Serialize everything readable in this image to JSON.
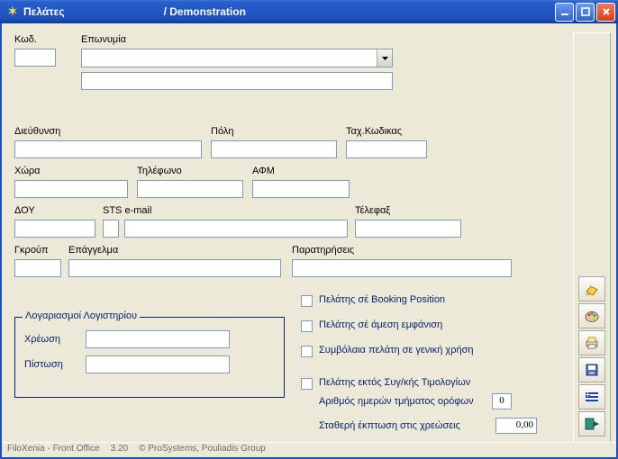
{
  "window": {
    "title": "Πελάτες",
    "subtitle": "/ Demonstration"
  },
  "labels": {
    "kod": "Κωδ.",
    "eponymia": "Επωνυμία",
    "dieythinsi": "Διεύθυνση",
    "poli": "Πόλη",
    "tax_kodikas": "Ταχ.Κωδικας",
    "xora": "Χώρα",
    "tilefono": "Τηλέφωνο",
    "afm": "ΑΦΜ",
    "doy": "ΔΟΥ",
    "sts_email": "STS e-mail",
    "telefax": "Τέλεφαξ",
    "group": "Γκρούπ",
    "epaggelma": "Επάγγελμα",
    "paratiriseis": "Παρατηρήσεις",
    "logariasmoi": "Λογαριασμοί Λογιστηρίου",
    "xreosi": "Χρέωση",
    "pistosi": "Πίστωση",
    "chk_booking": "Πελάτης σέ Booking Position",
    "chk_amesi": "Πελάτης σέ άμεση εμφάνιση",
    "chk_symvolaia": "Συμβόλαια πελάτη σε γενική χρήση",
    "chk_ektos": "Πελάτης εκτός Συγ/κής Τιμολογίων",
    "arithmos_imeron": "Αριθμός ημερών τμήματος ορόφων",
    "statheri_ekptosi": "Σταθερή έκπτωση στις χρεώσεις"
  },
  "values": {
    "kod": "",
    "eponymia_combo": "",
    "eponymia2": "",
    "dieythinsi": "",
    "poli": "",
    "tax_kodikas": "",
    "xora": "",
    "tilefono": "",
    "afm": "",
    "doy": "",
    "sts": "",
    "email": "",
    "telefax": "",
    "group": "",
    "epaggelma": "",
    "paratiriseis": "",
    "xreosi": "",
    "pistosi": "",
    "arithmos_imeron": "0",
    "statheri_ekptosi": "0,00"
  },
  "status": {
    "app": "FiloXenia - Front Office",
    "version": "3.20",
    "vendor": "© ProSystems, Pouliadis Group"
  }
}
